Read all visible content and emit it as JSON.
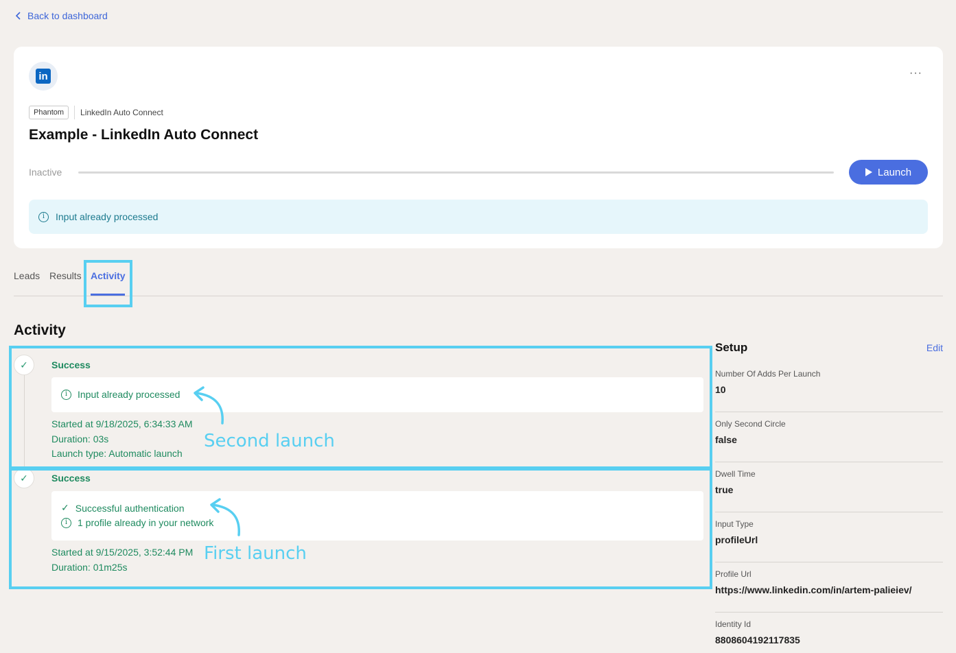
{
  "nav": {
    "back_label": "Back to dashboard"
  },
  "header": {
    "more_label": "···",
    "badge": "Phantom",
    "breadcrumb": "LinkedIn Auto Connect",
    "title": "Example - LinkedIn Auto Connect",
    "status": "Inactive",
    "progress": 0,
    "launch_label": "Launch",
    "info_banner": "Input already processed",
    "accent_color": "#4a6ee0"
  },
  "tabs": [
    {
      "label": "Leads"
    },
    {
      "label": "Results"
    },
    {
      "label": "Activity",
      "active": true
    }
  ],
  "activity": {
    "title": "Activity",
    "entries": [
      {
        "status": "Success",
        "messages": [
          {
            "icon": "info-icon",
            "text": "Input already processed"
          }
        ],
        "started": "Started at 9/18/2025, 6:34:33 AM",
        "duration": "Duration: 03s",
        "launch_type": "Launch type: Automatic launch",
        "annotation": "Second launch"
      },
      {
        "status": "Success",
        "messages": [
          {
            "icon": "check-icon",
            "text": "Successful authentication"
          },
          {
            "icon": "info-icon",
            "text": "1 profile already in your network"
          }
        ],
        "started": "Started at 9/15/2025, 3:52:44 PM",
        "duration": "Duration: 01m25s",
        "annotation": "First launch"
      }
    ]
  },
  "setup": {
    "title": "Setup",
    "edit_label": "Edit",
    "items": [
      {
        "label": "Number Of Adds Per Launch",
        "value": "10"
      },
      {
        "label": "Only Second Circle",
        "value": "false"
      },
      {
        "label": "Dwell Time",
        "value": "true"
      },
      {
        "label": "Input Type",
        "value": "profileUrl"
      },
      {
        "label": "Profile Url",
        "value": "https://www.linkedin.com/in/artem-palieiev/"
      },
      {
        "label": "Identity Id",
        "value": "8808604192117835"
      }
    ]
  },
  "highlight_color": "#58cff1"
}
